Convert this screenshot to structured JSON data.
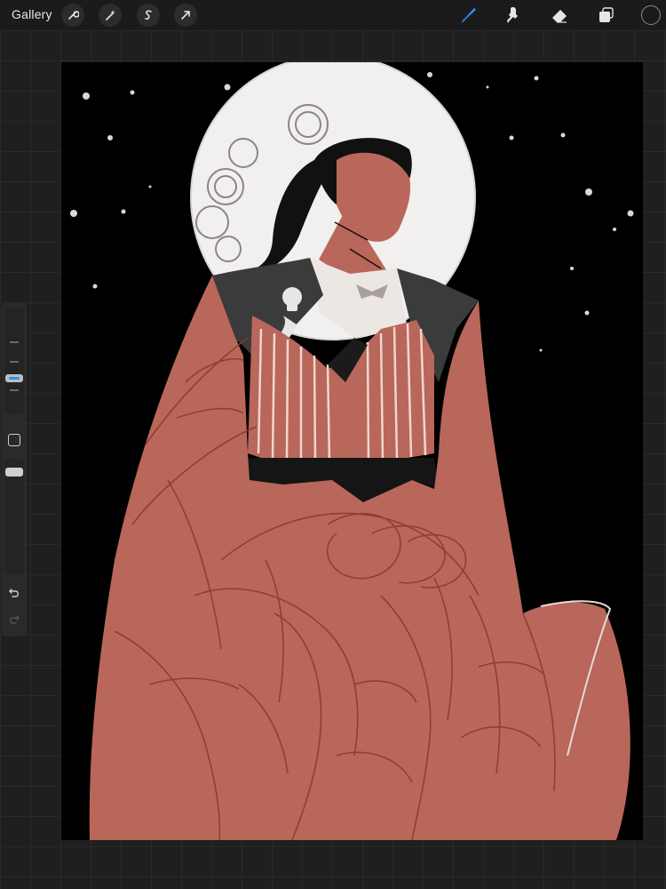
{
  "toolbar": {
    "gallery_label": "Gallery",
    "left_tools": [
      "wrench-icon",
      "magic-wand-icon",
      "selection-icon",
      "transform-arrow-icon"
    ],
    "right_tools": [
      "brush-icon",
      "smudge-icon",
      "eraser-icon",
      "layers-icon"
    ],
    "active_tool": "brush-icon",
    "accent_color": "#2f8cff",
    "current_color": "#1a1a1a"
  },
  "sidebar": {
    "controls": [
      "brush-size-slider",
      "modify-button",
      "opacity-slider",
      "undo-icon",
      "redo-icon"
    ]
  },
  "canvas": {
    "background_color": "#000000",
    "figure_color": "#b8675a",
    "sketch_line_color": "#8e3a2c",
    "moon_color": "#f2efef"
  }
}
